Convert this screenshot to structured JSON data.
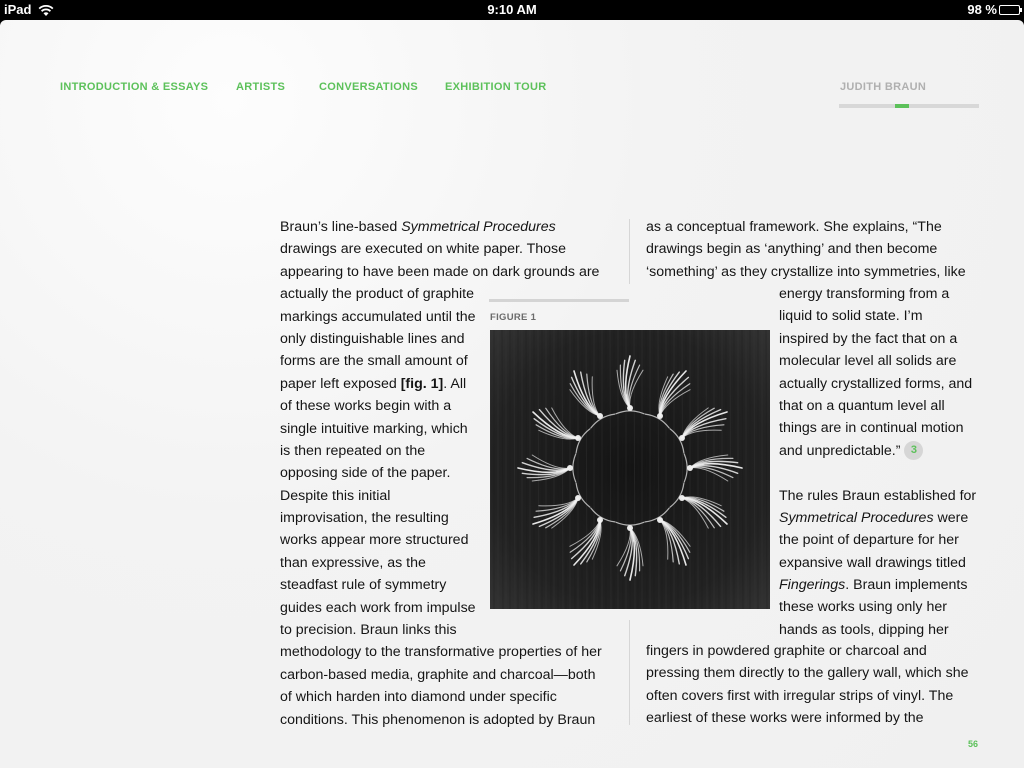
{
  "status_bar": {
    "device": "iPad",
    "time": "9:10 AM",
    "battery": "98 %",
    "battery_level": 0.98
  },
  "nav": {
    "items": [
      "INTRODUCTION & ESSAYS",
      "ARTISTS",
      "CONVERSATIONS",
      "EXHIBITION TOUR"
    ]
  },
  "section": {
    "label": "JUDITH BRAUN",
    "progress": 0.43
  },
  "colors": {
    "accent": "#5cc15a",
    "text": "#151515",
    "background": "#f0f0f0"
  },
  "figure": {
    "label": "FIGURE 1",
    "image_icon": "symmetrical-drawing-image"
  },
  "left_column": {
    "lines": [
      [
        "Braun’s line-based ",
        [
          "i",
          "Symmetrical Procedures"
        ]
      ],
      [
        "drawings are executed on white paper. Those"
      ],
      [
        "appearing to have been made on dark grounds are"
      ],
      [
        "actually the product of graphite"
      ],
      [
        "markings accumulated until the"
      ],
      [
        "only distinguishable lines and"
      ],
      [
        "forms are the small amount of"
      ],
      [
        "paper left exposed ",
        [
          "b",
          "[fig. 1]"
        ],
        ". All"
      ],
      [
        "of these works begin with a"
      ],
      [
        "single intuitive marking, which"
      ],
      [
        "is then repeated on the"
      ],
      [
        "opposing side of the paper."
      ],
      [
        "Despite this initial"
      ],
      [
        "improvisation, the resulting"
      ],
      [
        "works appear more structured"
      ],
      [
        "than expressive, as the"
      ],
      [
        "steadfast rule of symmetry"
      ],
      [
        "guides each work from impulse"
      ],
      [
        "to precision. Braun links this"
      ],
      [
        "methodology to the transformative properties of her"
      ],
      [
        "carbon-based media, graphite and charcoal—both"
      ],
      [
        "of which harden into diamond under specific"
      ],
      [
        "conditions. This phenomenon is adopted by Braun"
      ]
    ]
  },
  "right_column": {
    "top_lines": [
      [
        "as a conceptual framework. She explains, “The"
      ],
      [
        "drawings begin as ‘anything’ and then become"
      ],
      [
        "‘something’ as they crystallize into symmetries, like"
      ]
    ],
    "middle_lines": [
      [
        "energy transforming from a"
      ],
      [
        "liquid to solid state. I’m"
      ],
      [
        "inspired by the fact that on a"
      ],
      [
        "molecular level all solids are"
      ],
      [
        "actually crystallized forms, and"
      ],
      [
        "that on a quantum level all"
      ],
      [
        "things are in continual motion"
      ],
      [
        "and unpredictable.”"
      ],
      [
        ""
      ],
      [
        "The rules Braun established for"
      ],
      [
        [
          "i",
          "Symmetrical Procedures"
        ],
        " were"
      ],
      [
        "the point of departure for her"
      ],
      [
        "expansive wall drawings titled"
      ],
      [
        [
          "i",
          "Fingerings"
        ],
        ". Braun implements"
      ],
      [
        "these works using only her"
      ],
      [
        "hands as tools, dipping her"
      ]
    ],
    "bottom_lines": [
      [
        "fingers in powdered graphite or charcoal and"
      ],
      [
        "pressing them directly to the gallery wall, which she"
      ],
      [
        "often covers first with irregular strips of vinyl. The"
      ],
      [
        "earliest of these works were informed by the"
      ]
    ],
    "footnote": "3"
  },
  "page_number": "56"
}
